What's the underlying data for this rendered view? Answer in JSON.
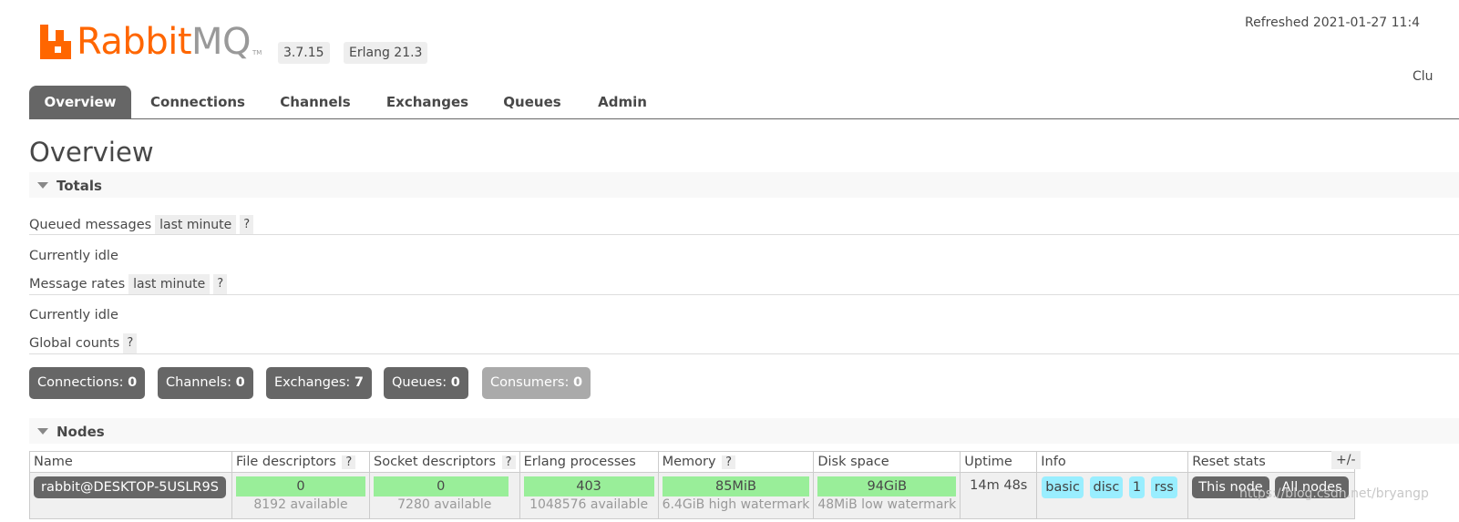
{
  "header": {
    "logo_rabbit": "Rabbit",
    "logo_mq": "MQ",
    "logo_tm": "TM",
    "version": "3.7.15",
    "erlang": "Erlang 21.3",
    "refreshed": "Refreshed 2021-01-27 11:4",
    "cluster_partial": "Clu"
  },
  "tabs": [
    "Overview",
    "Connections",
    "Channels",
    "Exchanges",
    "Queues",
    "Admin"
  ],
  "page_title": "Overview",
  "totals": {
    "title": "Totals",
    "queued_label": "Queued messages",
    "queued_period": "last minute",
    "help": "?",
    "idle1": "Currently idle",
    "rates_label": "Message rates",
    "rates_period": "last minute",
    "idle2": "Currently idle",
    "global_label": "Global counts"
  },
  "counts": [
    {
      "label": "Connections:",
      "value": "0"
    },
    {
      "label": "Channels:",
      "value": "0"
    },
    {
      "label": "Exchanges:",
      "value": "7"
    },
    {
      "label": "Queues:",
      "value": "0"
    },
    {
      "label": "Consumers:",
      "value": "0"
    }
  ],
  "nodes": {
    "title": "Nodes",
    "plusminus": "+/-",
    "columns": [
      "Name",
      "File descriptors",
      "Socket descriptors",
      "Erlang processes",
      "Memory",
      "Disk space",
      "Uptime",
      "Info",
      "Reset stats"
    ],
    "row": {
      "name": "rabbit@DESKTOP-5USLR9S",
      "file_desc": "0",
      "file_desc_sub": "8192 available",
      "socket_desc": "0",
      "socket_desc_sub": "7280 available",
      "erlang_proc": "403",
      "erlang_proc_sub": "1048576 available",
      "memory": "85MiB",
      "memory_sub": "6.4GiB high watermark",
      "disk": "94GiB",
      "disk_sub": "48MiB low watermark",
      "uptime": "14m 48s",
      "info_tags": [
        "basic",
        "disc",
        "1",
        "rss"
      ],
      "reset_this": "This node",
      "reset_all": "All nodes"
    }
  },
  "watermark": "https://blog.csdn.net/bryangp",
  "colors": {
    "brand_orange": "#ff6600",
    "tab_active": "#666666",
    "bar_green": "#99ee99",
    "info_tag": "#99eeff"
  }
}
